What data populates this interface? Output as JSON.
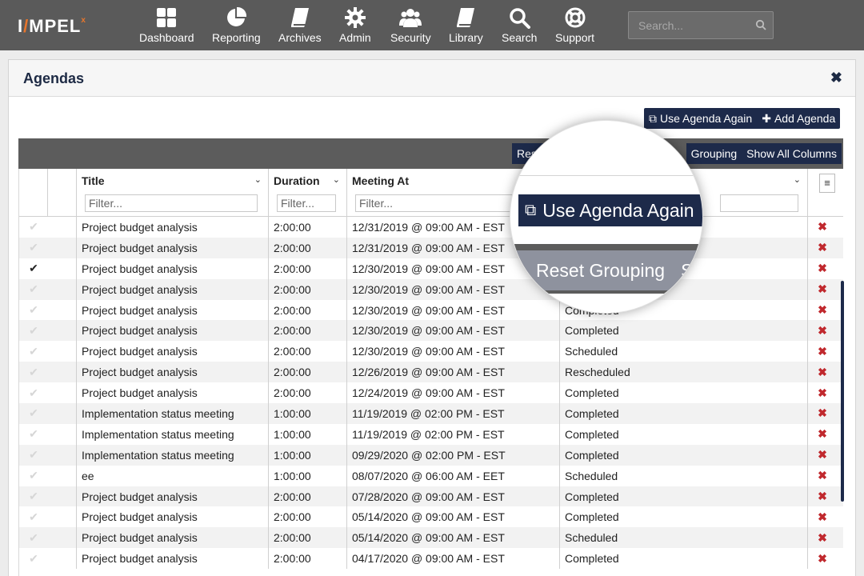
{
  "brand": {
    "logo_text": "IMPEL",
    "logo_sup": "x"
  },
  "nav": {
    "items": [
      {
        "id": "dashboard",
        "label": "Dashboard",
        "icon": "dashboard-icon"
      },
      {
        "id": "reporting",
        "label": "Reporting",
        "icon": "pie-chart-icon"
      },
      {
        "id": "archives",
        "label": "Archives",
        "icon": "book-icon"
      },
      {
        "id": "admin",
        "label": "Admin",
        "icon": "gear-icon"
      },
      {
        "id": "security",
        "label": "Security",
        "icon": "users-icon"
      },
      {
        "id": "library",
        "label": "Library",
        "icon": "book-icon"
      },
      {
        "id": "search",
        "label": "Search",
        "icon": "search-icon"
      },
      {
        "id": "support",
        "label": "Support",
        "icon": "lifebuoy-icon"
      }
    ],
    "search_placeholder": "Search..."
  },
  "panel": {
    "title": "Agendas",
    "close_symbol": "✖",
    "use_again_label": "Use Agenda Again",
    "add_agenda_label": "Add Agenda"
  },
  "grid_toolbar": {
    "reset_partial": "Rese",
    "grouping_partial": "Grouping",
    "show_all_label": "Show All Columns"
  },
  "columns": {
    "title": "Title",
    "duration": "Duration",
    "meeting_at": "Meeting At",
    "filter_placeholder": "Filter...",
    "menu_symbol": "≡"
  },
  "rows": [
    {
      "title": "Project budget analysis",
      "duration": "2:00:00",
      "meeting_at": "12/31/2019 @ 09:00 AM - EST",
      "status": "",
      "checked": false
    },
    {
      "title": "Project budget analysis",
      "duration": "2:00:00",
      "meeting_at": "12/31/2019 @ 09:00 AM - EST",
      "status": "",
      "checked": false
    },
    {
      "title": "Project budget analysis",
      "duration": "2:00:00",
      "meeting_at": "12/30/2019 @ 09:00 AM - EST",
      "status": "",
      "checked": true
    },
    {
      "title": "Project budget analysis",
      "duration": "2:00:00",
      "meeting_at": "12/30/2019 @ 09:00 AM - EST",
      "status": "",
      "checked": false
    },
    {
      "title": "Project budget analysis",
      "duration": "2:00:00",
      "meeting_at": "12/30/2019 @ 09:00 AM - EST",
      "status": "Completed",
      "checked": false
    },
    {
      "title": "Project budget analysis",
      "duration": "2:00:00",
      "meeting_at": "12/30/2019 @ 09:00 AM - EST",
      "status": "Completed",
      "checked": false
    },
    {
      "title": "Project budget analysis",
      "duration": "2:00:00",
      "meeting_at": "12/30/2019 @ 09:00 AM - EST",
      "status": "Scheduled",
      "checked": false
    },
    {
      "title": "Project budget analysis",
      "duration": "2:00:00",
      "meeting_at": "12/26/2019 @ 09:00 AM - EST",
      "status": "Rescheduled",
      "checked": false
    },
    {
      "title": "Project budget analysis",
      "duration": "2:00:00",
      "meeting_at": "12/24/2019 @ 09:00 AM - EST",
      "status": "Completed",
      "checked": false
    },
    {
      "title": "Implementation status meeting",
      "duration": "1:00:00",
      "meeting_at": "11/19/2019 @ 02:00 PM - EST",
      "status": "Completed",
      "checked": false
    },
    {
      "title": "Implementation status meeting",
      "duration": "1:00:00",
      "meeting_at": "11/19/2019 @ 02:00 PM - EST",
      "status": "Completed",
      "checked": false
    },
    {
      "title": "Implementation status meeting",
      "duration": "1:00:00",
      "meeting_at": "09/29/2020 @ 02:00 PM - EST",
      "status": "Completed",
      "checked": false
    },
    {
      "title": "ee",
      "duration": "1:00:00",
      "meeting_at": "08/07/2020 @ 06:00 AM - EET",
      "status": "Scheduled",
      "checked": false
    },
    {
      "title": "Project budget analysis",
      "duration": "2:00:00",
      "meeting_at": "07/28/2020 @ 09:00 AM - EST",
      "status": "Completed",
      "checked": false
    },
    {
      "title": "Project budget analysis",
      "duration": "2:00:00",
      "meeting_at": "05/14/2020 @ 09:00 AM - EST",
      "status": "Completed",
      "checked": false
    },
    {
      "title": "Project budget analysis",
      "duration": "2:00:00",
      "meeting_at": "05/14/2020 @ 09:00 AM - EST",
      "status": "Scheduled",
      "checked": false
    },
    {
      "title": "Project budget analysis",
      "duration": "2:00:00",
      "meeting_at": "04/17/2020 @ 09:00 AM - EST",
      "status": "Completed",
      "checked": false
    }
  ],
  "magnifier": {
    "button_label": "Use Agenda Again",
    "bar_label": "Reset Grouping",
    "bar_trailing": "S"
  },
  "colors": {
    "nav_bg": "#5a5a5a",
    "navy": "#1d2a4a",
    "accent_orange": "#e8762c",
    "delete_red": "#c0282d"
  }
}
